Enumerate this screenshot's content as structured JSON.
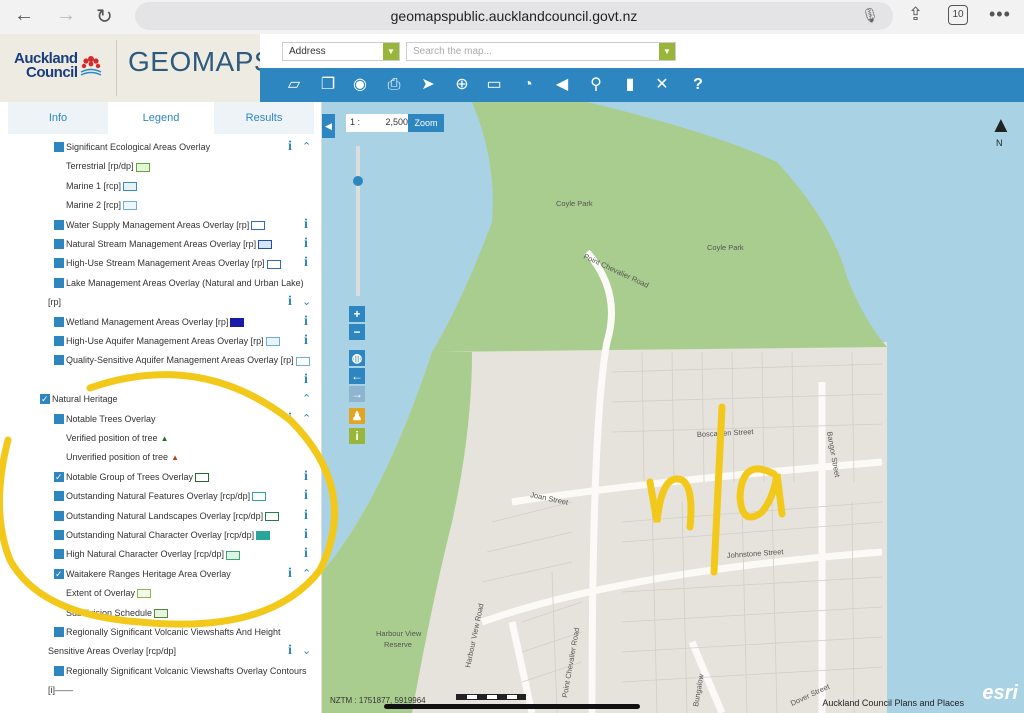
{
  "browser": {
    "url": "geomapspublic.aucklandcouncil.govt.nz",
    "tab_count": "10",
    "icons": [
      "back-icon",
      "forward-icon",
      "reload-icon",
      "microphone-icon",
      "share-icon",
      "more-icon"
    ]
  },
  "header": {
    "logo_line1": "Auckland",
    "logo_line2": "Council",
    "app_name": "GEOMAPS",
    "search_type": "Address",
    "search_placeholder": "Search the map..."
  },
  "toolbar": {
    "tools": [
      "layers-icon",
      "copy-icon",
      "eye-icon",
      "print-icon",
      "pointer-icon",
      "locate-icon",
      "measure-icon",
      "timer-icon",
      "camera-icon",
      "pin-icon",
      "bookmark-icon",
      "tools-icon",
      "help-icon"
    ],
    "help_label": "?"
  },
  "panel": {
    "tabs": [
      "Info",
      "Legend",
      "Results"
    ],
    "active_tab": "Legend",
    "items": [
      {
        "label": "Significant Ecological Areas Overlay",
        "indent": 1,
        "checkbox": true,
        "checked": false,
        "info": true,
        "chevron": "up"
      },
      {
        "label": "Terrestrial [rp/dp]",
        "indent": 2,
        "symbol": "sea-terrestrial"
      },
      {
        "label": "Marine 1 [rcp]",
        "indent": 2,
        "symbol": "sea-marine1"
      },
      {
        "label": "Marine 2 [rcp]",
        "indent": 2,
        "symbol": "sea-marine2"
      },
      {
        "label": "Water Supply Management Areas Overlay [rp]",
        "indent": 1,
        "checkbox": true,
        "info": true,
        "symbol": "water-supply"
      },
      {
        "label": "Natural Stream Management Areas Overlay [rp]",
        "indent": 1,
        "checkbox": true,
        "info": true,
        "symbol": "natural-stream"
      },
      {
        "label": "High-Use Stream Management Areas Overlay [rp]",
        "indent": 1,
        "checkbox": true,
        "info": true,
        "symbol": "high-use-stream"
      },
      {
        "label": "Lake Management Areas Overlay (Natural and Urban Lake)",
        "indent": 1,
        "checkbox": true
      },
      {
        "label": "[rp]",
        "indent": 0,
        "info": true,
        "chevron": "down"
      },
      {
        "label": "Wetland Management Areas Overlay [rp]",
        "indent": 1,
        "checkbox": true,
        "info": true,
        "symbol": "wetland"
      },
      {
        "label": "High-Use Aquifer Management Areas Overlay [rp]",
        "indent": 1,
        "checkbox": true,
        "info": true,
        "symbol": "aquifer"
      },
      {
        "label": "Quality-Sensitive Aquifer Management Areas Overlay [rp]",
        "indent": 1,
        "checkbox": true,
        "symbol": "quality-aquifer"
      },
      {
        "label": "",
        "indent": 0,
        "info": true
      },
      {
        "label": "Natural Heritage",
        "indent": 0,
        "checkbox": true,
        "checked": true,
        "chevron": "up"
      },
      {
        "label": "Notable Trees Overlay",
        "indent": 1,
        "checkbox": true,
        "info": true,
        "chevron": "up"
      },
      {
        "label": "Verified position of tree",
        "indent": 2,
        "symbol": "tree-verified"
      },
      {
        "label": "Unverified position of tree",
        "indent": 2,
        "symbol": "tree-unverified"
      },
      {
        "label": "Notable Group of Trees Overlay",
        "indent": 1,
        "checkbox": true,
        "checked": true,
        "info": true,
        "symbol": "tree-group"
      },
      {
        "label": "Outstanding Natural Features Overlay [rcp/dp]",
        "indent": 1,
        "checkbox": true,
        "info": true,
        "symbol": "onf"
      },
      {
        "label": "Outstanding Natural Landscapes Overlay [rcp/dp]",
        "indent": 1,
        "checkbox": true,
        "info": true,
        "symbol": "onl"
      },
      {
        "label": "Outstanding Natural Character Overlay [rcp/dp]",
        "indent": 1,
        "checkbox": true,
        "info": true,
        "symbol": "onc"
      },
      {
        "label": "High Natural Character Overlay [rcp/dp]",
        "indent": 1,
        "checkbox": true,
        "info": true,
        "symbol": "hnc"
      },
      {
        "label": "Waitakere Ranges Heritage Area Overlay",
        "indent": 1,
        "checkbox": true,
        "checked": true,
        "info": true,
        "chevron": "up"
      },
      {
        "label": "Extent of Overlay",
        "indent": 2,
        "symbol": "waitakere-extent"
      },
      {
        "label": "Subdivision Schedule",
        "indent": 2,
        "symbol": "subdivision"
      },
      {
        "label": "Regionally Significant Volcanic Viewshafts And Height",
        "indent": 1,
        "checkbox": true
      },
      {
        "label": "Sensitive Areas Overlay [rcp/dp]",
        "indent": 0,
        "info": true,
        "chevron": "down"
      },
      {
        "label": "Regionally Significant Volcanic Viewshafts Overlay Contours",
        "indent": 1,
        "checkbox": true
      },
      {
        "label": "[i]——",
        "indent": 0
      }
    ]
  },
  "map": {
    "scale_prefix": "1 :",
    "scale_value": "2,500",
    "zoom_label": "Zoom",
    "north_label": "N",
    "coords": "NZTM : 1751877, 5919964",
    "attribution": "Auckland Council Plans and Places",
    "esri": "esri",
    "places": {
      "coyle_park_1": "Coyle Park",
      "coyle_park_2": "Coyle Park",
      "harbour_view_reserve_1": "Harbour View",
      "harbour_view_reserve_2": "Reserve"
    },
    "streets": {
      "point_chevalier_road_curve": "Point Chevalier Road",
      "point_chevalier_road": "Point Chevalier Road",
      "boscawen": "Boscawen Street",
      "bangor": "Bangor Street",
      "joan": "Joan Street",
      "johnstone": "Johnstone Street",
      "harbour_view_road": "Harbour View Road",
      "dover": "Dover Street",
      "bungalow": "Bungalow"
    },
    "handwriting": "n/a",
    "colors": {
      "water": "#a9d2e4",
      "park": "#a9cd8e",
      "land": "#e6e3dc",
      "annotation": "#f2c81a"
    }
  }
}
